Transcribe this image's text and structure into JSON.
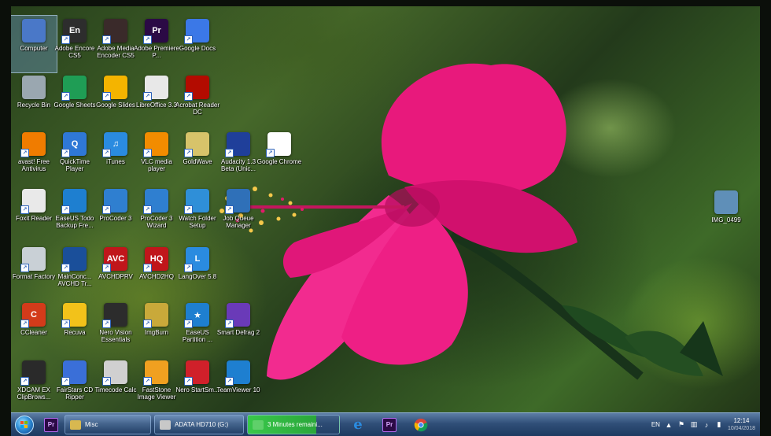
{
  "desktop": {
    "icons": [
      {
        "id": "computer",
        "label": "Computer",
        "col": 0,
        "row": 0,
        "glyph": "",
        "color": "#4a78c8",
        "selected": true,
        "shortcut": false
      },
      {
        "id": "adobe-encore",
        "label": "Adobe Encore CS5",
        "col": 1,
        "row": 0,
        "glyph": "En",
        "color": "#2d2d2d",
        "shortcut": true
      },
      {
        "id": "adobe-media-encoder",
        "label": "Adobe Media Encoder CS5",
        "col": 2,
        "row": 0,
        "glyph": "",
        "color": "#3a2a2a",
        "shortcut": true
      },
      {
        "id": "adobe-premiere",
        "label": "Adobe Premiere P...",
        "col": 3,
        "row": 0,
        "glyph": "Pr",
        "color": "#2b0a45",
        "shortcut": true
      },
      {
        "id": "google-docs",
        "label": "Google Docs",
        "col": 4,
        "row": 0,
        "glyph": "",
        "color": "#3b78e7",
        "shortcut": true
      },
      {
        "id": "recycle-bin",
        "label": "Recycle Bin",
        "col": 0,
        "row": 1,
        "glyph": "",
        "color": "#9aa7b0",
        "shortcut": false
      },
      {
        "id": "google-sheets",
        "label": "Google Sheets",
        "col": 1,
        "row": 1,
        "glyph": "",
        "color": "#1f9d55",
        "shortcut": true
      },
      {
        "id": "google-slides",
        "label": "Google Slides",
        "col": 2,
        "row": 1,
        "glyph": "",
        "color": "#f4b400",
        "shortcut": true
      },
      {
        "id": "libreoffice",
        "label": "LibreOffice 3.3",
        "col": 3,
        "row": 1,
        "glyph": "",
        "color": "#e8e8e8",
        "shortcut": true
      },
      {
        "id": "acrobat-reader",
        "label": "Acrobat Reader DC",
        "col": 4,
        "row": 1,
        "glyph": "",
        "color": "#b30b00",
        "shortcut": true
      },
      {
        "id": "avast",
        "label": "avast! Free Antivirus",
        "col": 0,
        "row": 2,
        "glyph": "",
        "color": "#f07c00",
        "shortcut": true
      },
      {
        "id": "quicktime",
        "label": "QuickTime Player",
        "col": 1,
        "row": 2,
        "glyph": "Q",
        "color": "#2f78d6",
        "shortcut": true
      },
      {
        "id": "itunes",
        "label": "iTunes",
        "col": 2,
        "row": 2,
        "glyph": "♫",
        "color": "#2a8be0",
        "shortcut": true
      },
      {
        "id": "vlc",
        "label": "VLC media player",
        "col": 3,
        "row": 2,
        "glyph": "",
        "color": "#f28c00",
        "shortcut": true
      },
      {
        "id": "goldwave",
        "label": "GoldWave",
        "col": 4,
        "row": 2,
        "glyph": "",
        "color": "#d7c36a",
        "shortcut": true
      },
      {
        "id": "audacity",
        "label": "Audacity 1.3 Beta (Unic...",
        "col": 5,
        "row": 2,
        "glyph": "",
        "color": "#1f3f9a",
        "shortcut": true
      },
      {
        "id": "google-chrome",
        "label": "Google Chrome",
        "col": 6,
        "row": 2,
        "glyph": "",
        "color": "#ffffff",
        "shortcut": true
      },
      {
        "id": "foxit-reader",
        "label": "Foxit Reader",
        "col": 0,
        "row": 3,
        "glyph": "",
        "color": "#e9e9e9",
        "shortcut": true
      },
      {
        "id": "easeus-todo",
        "label": "EaseUS Todo Backup Fre...",
        "col": 1,
        "row": 3,
        "glyph": "",
        "color": "#1e7fd0",
        "shortcut": true
      },
      {
        "id": "procoder3",
        "label": "ProCoder 3",
        "col": 2,
        "row": 3,
        "glyph": "",
        "color": "#2f7fd0",
        "shortcut": true
      },
      {
        "id": "procoder3-wizard",
        "label": "ProCoder 3 Wizard",
        "col": 3,
        "row": 3,
        "glyph": "",
        "color": "#2f7fd0",
        "shortcut": true
      },
      {
        "id": "watch-folder",
        "label": "Watch Folder Setup",
        "col": 4,
        "row": 3,
        "glyph": "",
        "color": "#2f8fd8",
        "shortcut": true
      },
      {
        "id": "job-queue",
        "label": "Job Queue Manager",
        "col": 5,
        "row": 3,
        "glyph": "",
        "color": "#2f70b8",
        "shortcut": true
      },
      {
        "id": "format-factory",
        "label": "Format Factory",
        "col": 0,
        "row": 4,
        "glyph": "",
        "color": "#c9d0d6",
        "shortcut": true
      },
      {
        "id": "mainconcept",
        "label": "MainConc... AVCHD Tr...",
        "col": 1,
        "row": 4,
        "glyph": "",
        "color": "#1a4f9a",
        "shortcut": true
      },
      {
        "id": "avchdprv",
        "label": "AVCHDPRV",
        "col": 2,
        "row": 4,
        "glyph": "AVC",
        "color": "#c0161b",
        "shortcut": true
      },
      {
        "id": "avchd2hq",
        "label": "AVCHD2HQ",
        "col": 3,
        "row": 4,
        "glyph": "HQ",
        "color": "#c0161b",
        "shortcut": true
      },
      {
        "id": "langover",
        "label": "LangOver 5.8",
        "col": 4,
        "row": 4,
        "glyph": "L",
        "color": "#2a8be0",
        "shortcut": true
      },
      {
        "id": "ccleaner",
        "label": "CCleaner",
        "col": 0,
        "row": 5,
        "glyph": "C",
        "color": "#d33b1a",
        "shortcut": true
      },
      {
        "id": "recuva",
        "label": "Recuva",
        "col": 1,
        "row": 5,
        "glyph": "",
        "color": "#f2c21a",
        "shortcut": true
      },
      {
        "id": "nero-vision",
        "label": "Nero Vision Essentials",
        "col": 2,
        "row": 5,
        "glyph": "",
        "color": "#2c2c2c",
        "shortcut": true
      },
      {
        "id": "imgburn",
        "label": "ImgBurn",
        "col": 3,
        "row": 5,
        "glyph": "",
        "color": "#c9a93a",
        "shortcut": true
      },
      {
        "id": "easeus-partition",
        "label": "EaseUS Partition ...",
        "col": 4,
        "row": 5,
        "glyph": "★",
        "color": "#1e7fd0",
        "shortcut": true
      },
      {
        "id": "smart-defrag",
        "label": "Smart Defrag 2",
        "col": 5,
        "row": 5,
        "glyph": "",
        "color": "#6a3ab8",
        "shortcut": true
      },
      {
        "id": "xdcam",
        "label": "XDCAM EX ClipBrows...",
        "col": 0,
        "row": 6,
        "glyph": "",
        "color": "#2a2a2a",
        "shortcut": true
      },
      {
        "id": "fairstars",
        "label": "FairStars CD Ripper",
        "col": 1,
        "row": 6,
        "glyph": "",
        "color": "#3a6fd8",
        "shortcut": true
      },
      {
        "id": "timecode-calc",
        "label": "Timecode Calc",
        "col": 2,
        "row": 6,
        "glyph": "",
        "color": "#d0d0d0",
        "shortcut": true
      },
      {
        "id": "faststone",
        "label": "FastStone Image Viewer",
        "col": 3,
        "row": 6,
        "glyph": "",
        "color": "#f0a020",
        "shortcut": true
      },
      {
        "id": "nero-startsmart",
        "label": "Nero StartSm...",
        "col": 4,
        "row": 6,
        "glyph": "",
        "color": "#d0202a",
        "shortcut": true
      },
      {
        "id": "teamviewer",
        "label": "TeamViewer 10",
        "col": 5,
        "row": 6,
        "glyph": "",
        "color": "#1e7fd0",
        "shortcut": true
      }
    ],
    "right_icon": {
      "id": "img-file",
      "label": "IMG_0499",
      "glyph": "",
      "color": "#5f8fb8",
      "shortcut": false
    }
  },
  "taskbar": {
    "pinned": [
      {
        "id": "premiere-pin",
        "glyph": "Pr"
      }
    ],
    "tasks": [
      {
        "id": "task-misc",
        "label": "Misc",
        "icon_color": "#d8b850",
        "progress": false
      },
      {
        "id": "task-adata",
        "label": "ADATA HD710 (G:)",
        "icon_color": "#c8c8c8",
        "progress": false
      },
      {
        "id": "task-copy",
        "label": "3 Minutes remaini...",
        "icon_color": "#5fd06a",
        "progress": true
      }
    ],
    "apps": [
      {
        "id": "ie-app",
        "glyph": "e",
        "color": "#2a8be0"
      },
      {
        "id": "premiere-app",
        "glyph": "Pr",
        "color": "#2b0a45"
      },
      {
        "id": "chrome-app",
        "glyph": "",
        "color": "#ffffff"
      }
    ],
    "tray": {
      "language": "EN",
      "time": "12:14",
      "date": "10/04/2018"
    }
  }
}
